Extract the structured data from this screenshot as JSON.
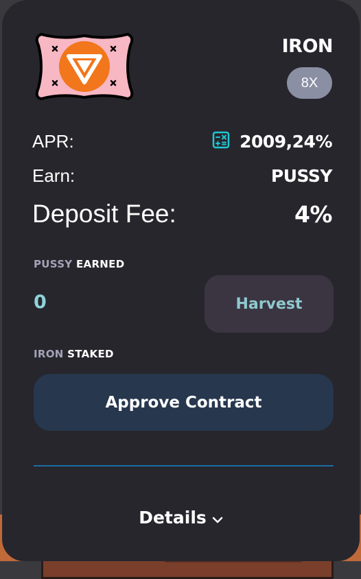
{
  "card": {
    "pair_title": "IRON",
    "multiplier": "8X",
    "apr_label": "APR:",
    "apr_value": "2009,24%",
    "earn_label": "Earn:",
    "earn_value": "PUSSY",
    "fee_label": "Deposit Fee:",
    "fee_value": "4%",
    "earned_token": "PUSSY",
    "earned_word": "EARNED",
    "earned_amount": "0",
    "harvest_label": "Harvest",
    "staked_token": "IRON",
    "staked_word": "STAKED",
    "approve_label": "Approve Contract",
    "details_label": "Details"
  },
  "icons": {
    "token_logo": "iron-token-logo",
    "calculator": "calculator-icon",
    "chevron": "chevron-down-icon"
  },
  "colors": {
    "card_bg": "#27262c",
    "multiplier_bg": "#8b8fa3",
    "accent_teal": "#8fd3da",
    "harvest_bg": "#3b3542",
    "approve_bg": "#26374e",
    "divider": "#1a6fa6",
    "calculator": "#1fc7d4",
    "logo_orange": "#f2761b",
    "logo_pink": "#f7b7c3"
  }
}
